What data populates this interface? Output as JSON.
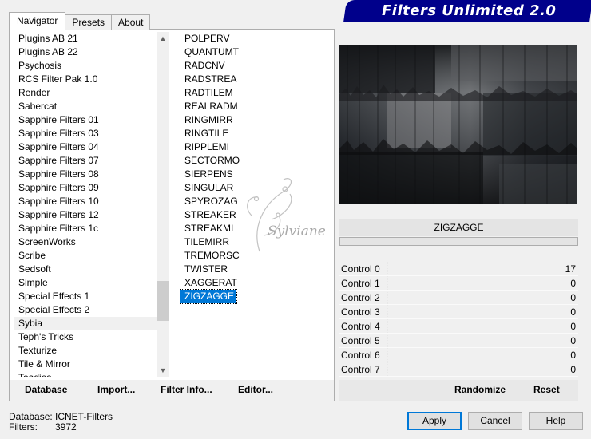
{
  "banner": {
    "title": "Filters Unlimited 2.0"
  },
  "tabs": [
    {
      "label": "Navigator",
      "active": true
    },
    {
      "label": "Presets",
      "active": false
    },
    {
      "label": "About",
      "active": false
    }
  ],
  "categories": [
    "Plugins AB 21",
    "Plugins AB 22",
    "Psychosis",
    "RCS Filter Pak 1.0",
    "Render",
    "Sabercat",
    "Sapphire Filters 01",
    "Sapphire Filters 03",
    "Sapphire Filters 04",
    "Sapphire Filters 07",
    "Sapphire Filters 08",
    "Sapphire Filters 09",
    "Sapphire Filters 10",
    "Sapphire Filters 12",
    "Sapphire Filters 1c",
    "ScreenWorks",
    "Scribe",
    "Sedsoft",
    "Simple",
    "Special Effects 1",
    "Special Effects 2",
    "Sybia",
    "Teph's Tricks",
    "Texturize",
    "Tile & Mirror",
    "Toadies"
  ],
  "selected_category": "Sybia",
  "filters": [
    "POLPERV",
    "QUANTUMT",
    "RADCNV",
    "RADSTREA",
    "RADTILEM",
    "REALRADM",
    "RINGMIRR",
    "RINGTILE",
    "RIPPLEMI",
    "SECTORMO",
    "SIERPENS",
    "SINGULAR",
    "SPYROZAG",
    "STREAKER",
    "STREAKMI",
    "TILEMIRR",
    "TREMORSC",
    "TWISTER",
    "XAGGERAT",
    "ZIGZAGGE"
  ],
  "selected_filter": "ZIGZAGGE",
  "filter_name": "ZIGZAGGE",
  "controls": [
    {
      "label": "Control 0",
      "value": "17"
    },
    {
      "label": "Control 1",
      "value": "0"
    },
    {
      "label": "Control 2",
      "value": "0"
    },
    {
      "label": "Control 3",
      "value": "0"
    },
    {
      "label": "Control 4",
      "value": "0"
    },
    {
      "label": "Control 5",
      "value": "0"
    },
    {
      "label": "Control 6",
      "value": "0"
    },
    {
      "label": "Control 7",
      "value": "0"
    }
  ],
  "lower_buttons": {
    "database": {
      "u": "D",
      "rest": "atabase"
    },
    "import": {
      "u": "I",
      "rest": "mport..."
    },
    "filter_info": {
      "pre": "Filter ",
      "u": "I",
      "rest": "nfo..."
    },
    "editor": {
      "u": "E",
      "rest": "ditor..."
    },
    "randomize": "Randomize",
    "reset": "Reset"
  },
  "footer": {
    "database_label": "Database:",
    "database_value": "ICNET-Filters",
    "filters_label": "Filters:",
    "filters_value": "3972"
  },
  "dialog_buttons": {
    "apply": "Apply",
    "cancel": "Cancel",
    "help": "Help"
  },
  "watermark_text": "Sylviane",
  "icons": {
    "scroll_up": "chevron-up-icon",
    "scroll_down": "chevron-down-icon"
  },
  "colors": {
    "banner": "#00008b",
    "selection": "#0078d7"
  }
}
